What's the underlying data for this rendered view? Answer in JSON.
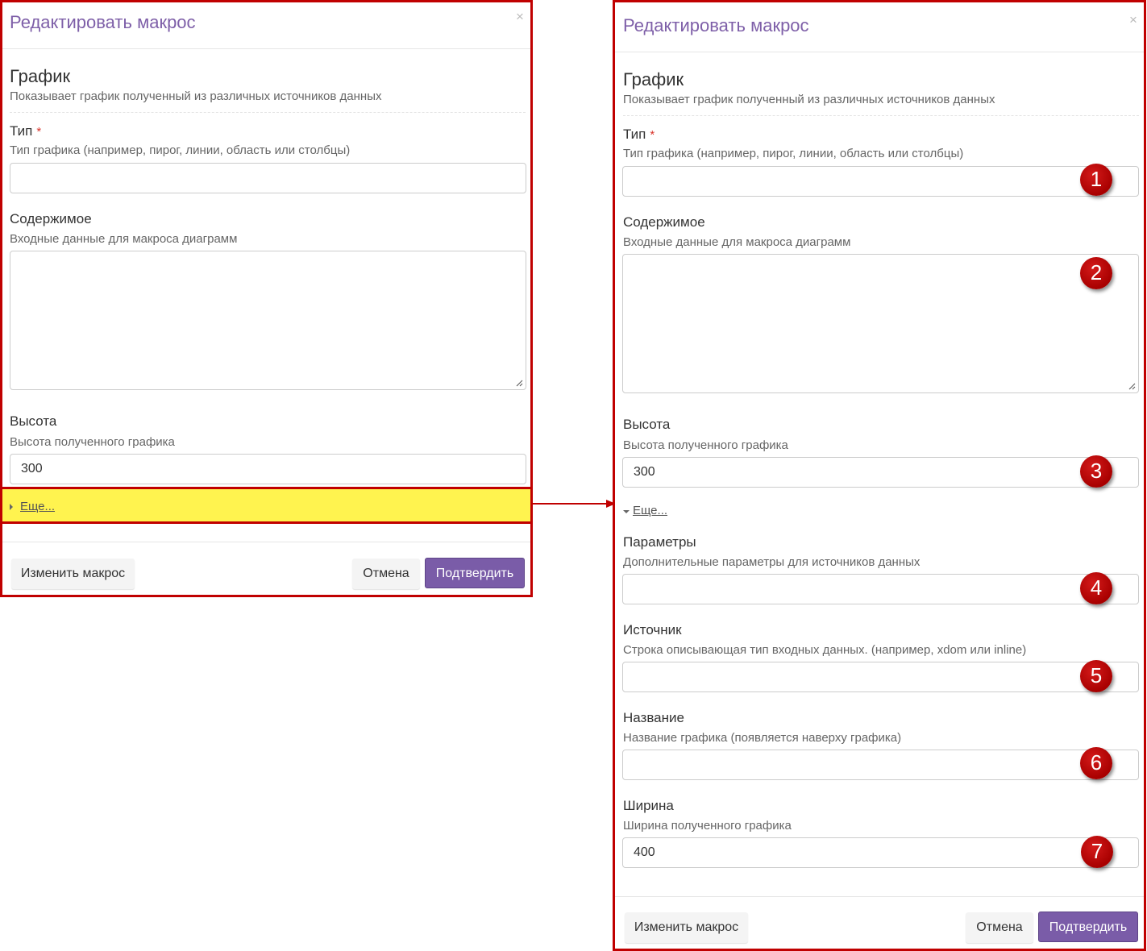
{
  "dialog": {
    "title": "Редактировать макрос",
    "close_symbol": "×",
    "section_title": "График",
    "section_desc": "Показывает график полученный из различных источников данных",
    "fields": {
      "type": {
        "label": "Тип",
        "required_mark": "*",
        "hint": "Тип графика (например, пирог, линии, область или столбцы)",
        "value": ""
      },
      "content": {
        "label": "Содержимое",
        "hint": "Входные данные для макроса диаграмм",
        "value": ""
      },
      "height": {
        "label": "Высота",
        "hint": "Высота полученного графика",
        "value": "300"
      },
      "params": {
        "label": "Параметры",
        "hint": "Дополнительные параметры для источников данных",
        "value": ""
      },
      "source": {
        "label": "Источник",
        "hint": "Строка описывающая тип входных данных. (например, xdom или inline)",
        "value": ""
      },
      "name": {
        "label": "Название",
        "hint": "Название графика (появляется наверху графика)",
        "value": ""
      },
      "width": {
        "label": "Ширина",
        "hint": "Ширина полученного графика",
        "value": "400"
      }
    },
    "more_link": "Еще...",
    "buttons": {
      "change": "Изменить макрос",
      "cancel": "Отмена",
      "confirm": "Подтвердить"
    }
  },
  "badges": [
    "1",
    "2",
    "3",
    "4",
    "5",
    "6",
    "7"
  ],
  "colors": {
    "accent": "#7a5ca8",
    "highlight_border": "#c00000",
    "highlight_fill": "#fff34f",
    "badge": "#c00000"
  }
}
